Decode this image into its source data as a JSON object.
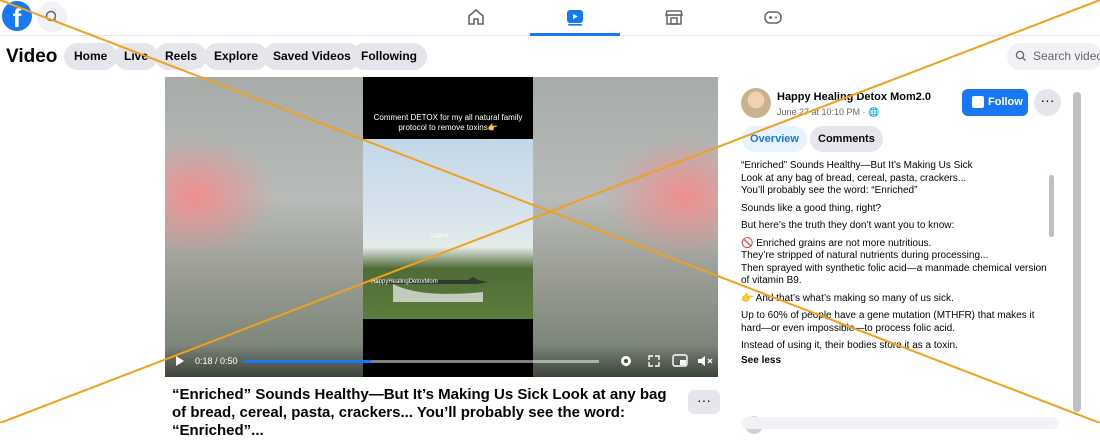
{
  "topbar": {
    "logo": "f",
    "nav": [
      {
        "icon": "home-icon",
        "active": false
      },
      {
        "icon": "video-icon",
        "active": true
      },
      {
        "icon": "marketplace-icon",
        "active": false
      },
      {
        "icon": "gaming-icon",
        "active": false
      }
    ],
    "accent": "#1877f2"
  },
  "video_header": {
    "title": "Video",
    "pills": [
      "Home",
      "Live",
      "Reels",
      "Explore",
      "Saved Videos",
      "Following"
    ],
    "search_placeholder": "Search videos"
  },
  "player": {
    "caption": "Comment DETOX for my all natural family protocol to remove toxins👉",
    "watermark1": "capcut",
    "watermark2": "HappyHealingDetoxMom",
    "time": "0:18 / 0:50",
    "progress": 0.36
  },
  "post": {
    "title": "“Enriched” Sounds Healthy—But It’s Making Us Sick Look at any bag of bread, cereal, pasta, crackers... You’ll probably see the word: “Enriched”...",
    "more": "···"
  },
  "side": {
    "author": "Happy Healing Detox Mom2.0",
    "date": "June 27 at 10:10 PM · 🌐",
    "follow": "Follow",
    "more": "···",
    "tabs": [
      "Overview",
      "Comments"
    ],
    "description": [
      "“Enriched” Sounds Healthy—But It’s Making Us Sick\nLook at any bag of bread, cereal, pasta, crackers...\nYou’ll probably see the word: “Enriched”",
      "Sounds like a good thing, right?",
      "But here’s the truth they don’t want you to know:",
      "🚫 Enriched grains are not more nutritious.\nThey’re stripped of natural nutrients during processing...\nThen sprayed with synthetic folic acid—a manmade chemical version of vitamin B9.",
      "👉 And that’s what’s making so many of us sick.",
      "Up to 60% of people have a gene mutation (MTHFR) that makes it hard—or even impossible—to process folic acid.",
      "Instead of using it, their bodies store it as a toxin."
    ],
    "see_less": "See less"
  },
  "overlay_color": "#f0a01e"
}
